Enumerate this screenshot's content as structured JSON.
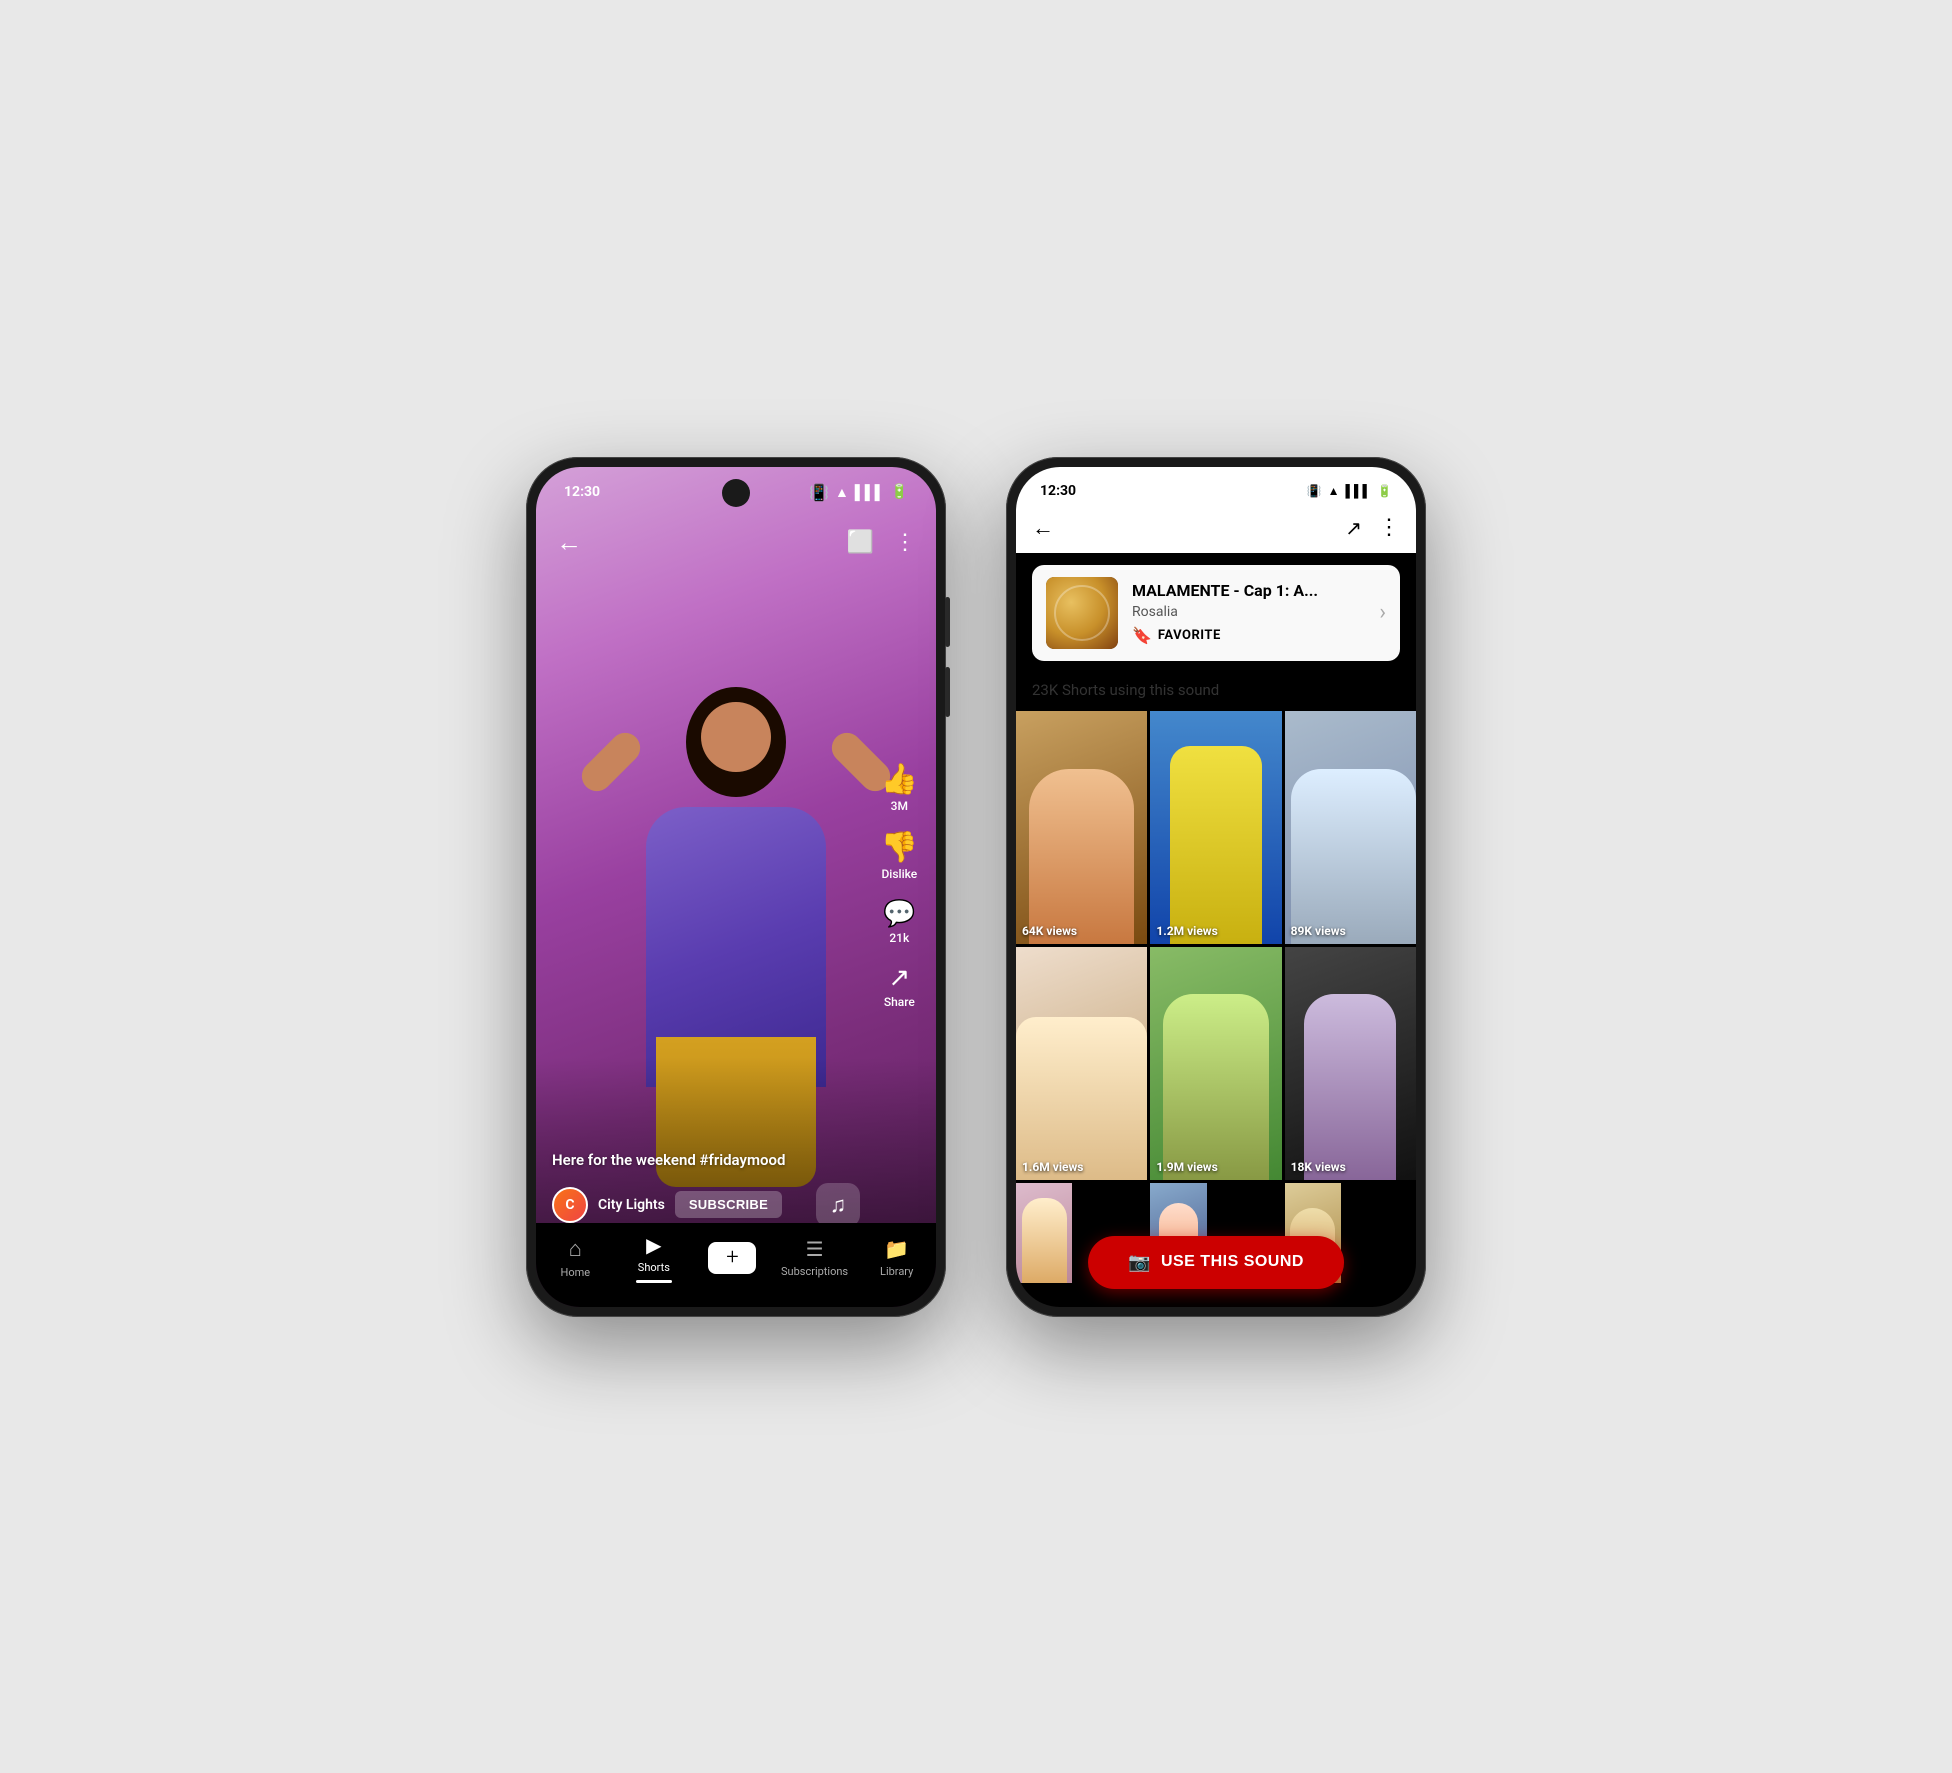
{
  "phone1": {
    "status": {
      "time": "12:30",
      "icons": [
        "vibrate",
        "wifi",
        "signal",
        "battery"
      ]
    },
    "topbar": {
      "back_icon": "←",
      "camera_icon": "📷",
      "more_icon": "⋮"
    },
    "actions": [
      {
        "icon": "👍",
        "label": "3M",
        "name": "like"
      },
      {
        "icon": "👎",
        "label": "Dislike",
        "name": "dislike"
      },
      {
        "icon": "💬",
        "label": "21k",
        "name": "comments"
      },
      {
        "icon": "➤",
        "label": "Share",
        "name": "share"
      }
    ],
    "caption": "Here for the weekend #fridaymood",
    "channel": {
      "name": "City Lights",
      "subscribe_label": "SUBSCRIBE"
    },
    "nav": [
      {
        "icon": "⌂",
        "label": "Home",
        "active": false
      },
      {
        "icon": "▶",
        "label": "Shorts",
        "active": true
      },
      {
        "icon": "+",
        "label": "",
        "active": false,
        "is_add": true
      },
      {
        "icon": "☰",
        "label": "Subscriptions",
        "active": false
      },
      {
        "icon": "📁",
        "label": "Library",
        "active": false
      }
    ]
  },
  "phone2": {
    "status": {
      "time": "12:30"
    },
    "topbar": {
      "back_icon": "←",
      "share_icon": "⎙",
      "more_icon": "⋮"
    },
    "sound": {
      "title": "MALAMENTE - Cap 1: A...",
      "artist": "Rosalia",
      "favorite_label": "FAVORITE"
    },
    "shorts_count": "23K Shorts using this sound",
    "grid": [
      {
        "views": "64K views",
        "bg": 1
      },
      {
        "views": "1.2M views",
        "bg": 2
      },
      {
        "views": "89K views",
        "bg": 3
      },
      {
        "views": "1.6M views",
        "bg": 4
      },
      {
        "views": "1.9M views",
        "bg": 5
      },
      {
        "views": "18K views",
        "bg": 6
      },
      {
        "views": "",
        "bg": 7
      },
      {
        "views": "",
        "bg": 8
      },
      {
        "views": "",
        "bg": 9
      }
    ],
    "use_sound_btn": "USE THIS SOUND"
  }
}
